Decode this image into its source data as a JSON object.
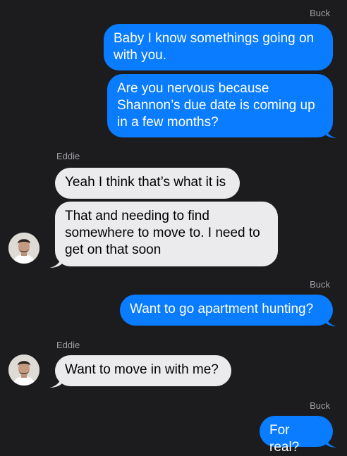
{
  "conversation": {
    "messages": [
      {
        "sender": "Buck",
        "direction": "outgoing",
        "text": "Baby I know somethings going on with you."
      },
      {
        "sender": "Buck",
        "direction": "outgoing",
        "text": "Are you nervous because Shannon’s due date is coming up in a few months?"
      },
      {
        "sender": "Eddie",
        "direction": "incoming",
        "text": "Yeah I think that’s what it is"
      },
      {
        "sender": "Eddie",
        "direction": "incoming",
        "text": "That and needing to find somewhere to move to. I need to get on that soon"
      },
      {
        "sender": "Buck",
        "direction": "outgoing",
        "text": "Want to go apartment hunting?"
      },
      {
        "sender": "Eddie",
        "direction": "incoming",
        "text": "Want to move in with me?"
      },
      {
        "sender": "Buck",
        "direction": "outgoing",
        "text": "For real?"
      }
    ],
    "sender_labels": [
      "Buck",
      "Eddie",
      "Buck",
      "Eddie",
      "Buck"
    ]
  },
  "colors": {
    "background": "#1c1c1e",
    "outgoing_bubble": "#0a7cff",
    "incoming_bubble": "#ebebed",
    "sender_label": "#a0a0a6"
  },
  "icons": {
    "avatar": "contact-photo-eddie"
  }
}
